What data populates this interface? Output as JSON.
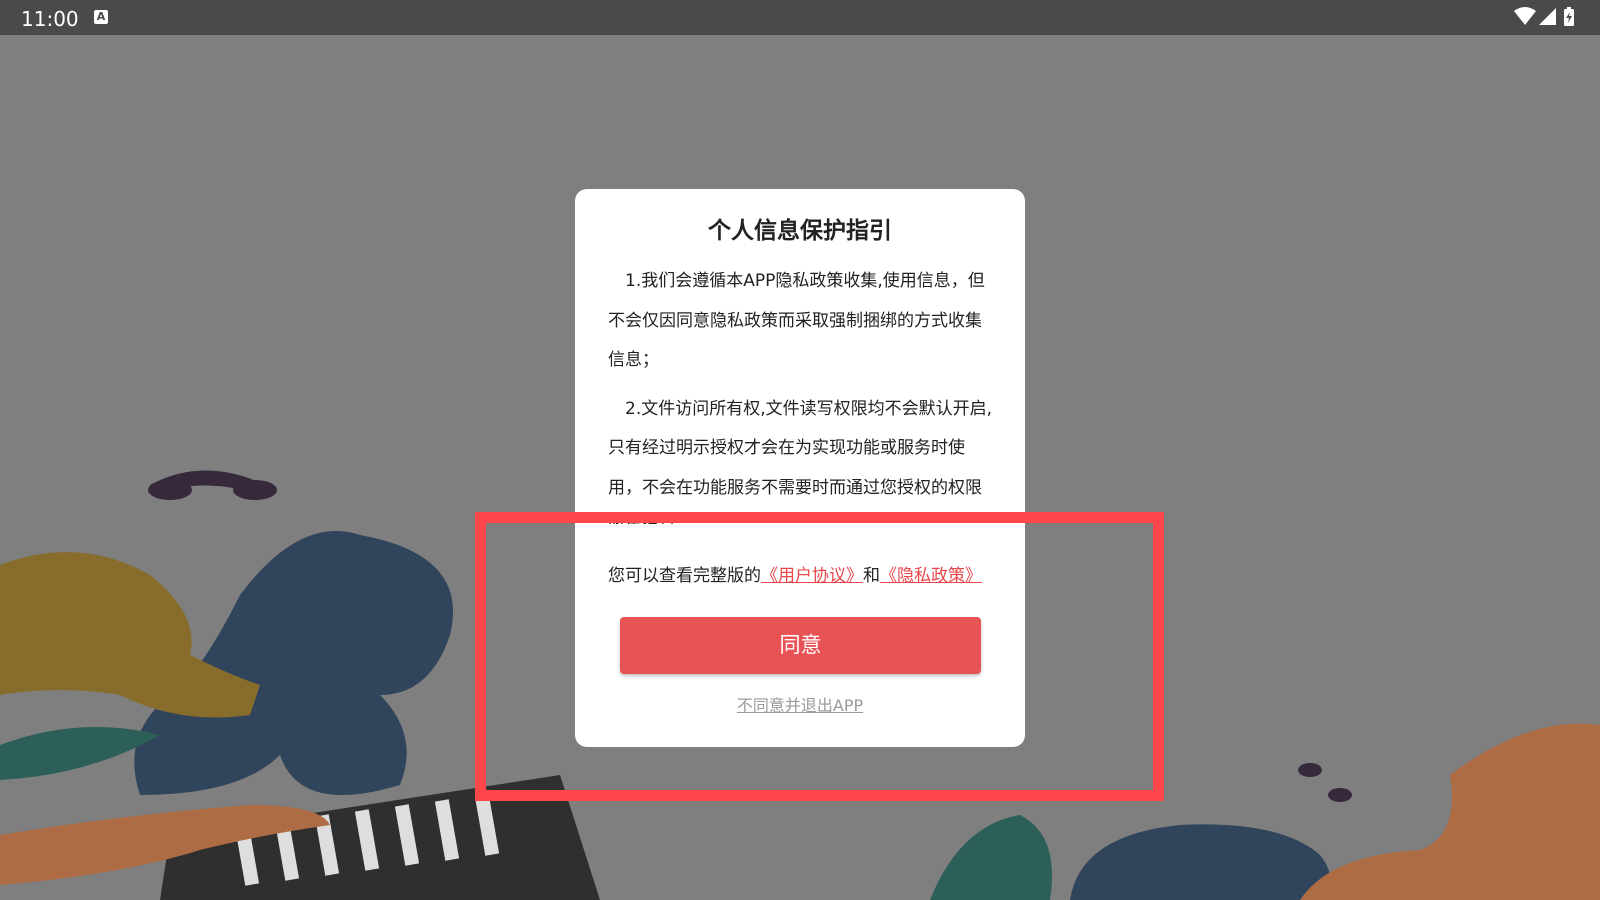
{
  "status_bar": {
    "time": "11:00",
    "indicator_icon": "A",
    "icons": [
      "wifi-icon",
      "signal-icon",
      "battery-charging-icon"
    ]
  },
  "dialog": {
    "title": "个人信息保护指引",
    "paragraph1": "1.我们会遵循本APP隐私政策收集,使用信息，但不会仅因同意隐私政策而采取强制捆绑的方式收集信息；",
    "paragraph2": "2.文件访问所有权,文件读写权限均不会默认开启,只有经过明示授权才会在为实现功能或服务时使用，不会在功能服务不需要时而通过您授权的权限收集信息。",
    "links_prefix": "您可以查看完整版的",
    "user_agreement_link": "《用户协议》",
    "links_joiner": "和",
    "privacy_policy_link": "《隐私政策》",
    "agree_label": "同意",
    "disagree_label": "不同意并退出APP"
  },
  "colors": {
    "accent": "#e85456",
    "link": "#e8474b",
    "highlight_box": "#ff474b",
    "status_bar": "#4a4a4a",
    "dim_background": "#7f7f7f"
  }
}
